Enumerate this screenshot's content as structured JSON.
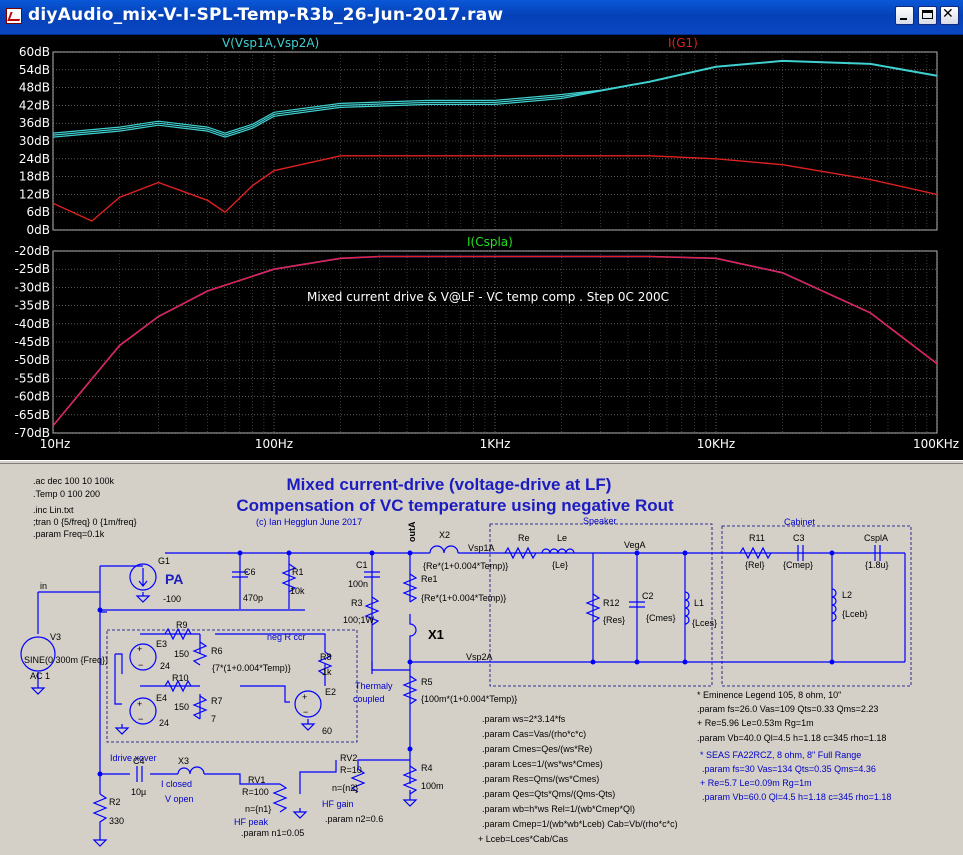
{
  "window": {
    "title": "diyAudio_mix-V-I-SPL-Temp-R3b_26-Jun-2017.raw",
    "buttons": [
      "minimize",
      "maximize",
      "close"
    ]
  },
  "plots": {
    "top_pane": {
      "traces": [
        {
          "label": "V(Vsp1A,Vsp2A)",
          "color": "#40d0d0"
        },
        {
          "label": "I(G1)",
          "color": "#e02020"
        }
      ],
      "y_ticks": [
        "60dB",
        "54dB",
        "48dB",
        "42dB",
        "36dB",
        "30dB",
        "24dB",
        "18dB",
        "12dB",
        "6dB",
        "0dB"
      ]
    },
    "bottom_pane": {
      "traces": [
        {
          "label": "I(Cspla)",
          "color": "#20e020"
        }
      ],
      "annotation": "Mixed current drive & V@LF - VC temp comp . Step 0C 200C",
      "y_ticks": [
        "-20dB",
        "-25dB",
        "-30dB",
        "-35dB",
        "-40dB",
        "-45dB",
        "-50dB",
        "-55dB",
        "-60dB",
        "-65dB",
        "-70dB"
      ]
    },
    "x_ticks": [
      "10Hz",
      "100Hz",
      "1KHz",
      "10KHz",
      "100KHz"
    ]
  },
  "chart_data": [
    {
      "type": "line",
      "x_scale": "log",
      "xlim": [
        10,
        100000
      ],
      "ylim": [
        0,
        60
      ],
      "series": [
        {
          "name": "V(Vsp1A,Vsp2A)",
          "x": [
            10,
            20,
            30,
            50,
            60,
            80,
            100,
            200,
            500,
            1000,
            2000,
            3000,
            5000,
            10000,
            20000,
            50000,
            100000
          ],
          "values": [
            32,
            34,
            36,
            34,
            32,
            35,
            39,
            42,
            43,
            43,
            45,
            47,
            50,
            55,
            57,
            56,
            52
          ]
        },
        {
          "name": "I(G1)",
          "x": [
            10,
            15,
            20,
            30,
            50,
            60,
            80,
            100,
            200,
            500,
            1000,
            3000,
            5000,
            10000,
            20000,
            50000,
            100000
          ],
          "values": [
            9,
            3,
            11,
            16,
            10,
            6,
            15,
            20,
            25,
            25,
            25,
            25,
            25,
            24,
            22,
            17,
            12
          ]
        }
      ]
    },
    {
      "type": "line",
      "x_scale": "log",
      "xlim": [
        10,
        100000
      ],
      "ylim": [
        -70,
        -20
      ],
      "series": [
        {
          "name": "I(Cspla)",
          "x": [
            10,
            20,
            30,
            50,
            100,
            200,
            300,
            500,
            1000,
            2000,
            5000,
            10000,
            20000,
            50000,
            100000
          ],
          "values": [
            -68,
            -46,
            -38,
            -31,
            -25,
            -22,
            -21.5,
            -21.5,
            -21.5,
            -21.5,
            -21.5,
            -22,
            -26,
            -37,
            -51
          ]
        }
      ]
    }
  ],
  "schematic": {
    "heading1": "Mixed current-drive (voltage-drive at LF)",
    "heading2": "Compensation of VC temperature using negative Rout",
    "credit": "(c) Ian Hegglun June 2017",
    "directives": [
      ".ac dec 100 10 100k",
      ".Temp 0 100 200",
      ".inc Lin.txt",
      ";tran 0 {5/freq} 0 {1m/freq}",
      ".param Freq=0.1k"
    ],
    "labels": {
      "speaker": "Speaker",
      "cabinet": "Cabinet",
      "g1": "G1",
      "g1_val": "-100",
      "pa": "PA",
      "c6": "C6",
      "c6_val": "470p",
      "r1": "R1",
      "r1_val": "10k",
      "c1": "C1",
      "c1_val": "100n",
      "r3": "R3",
      "r3_val": "100;1W",
      "re1": "Re1",
      "re1_val": "{Re*(1+0.004*Temp)}",
      "x1": "X1",
      "x2": "X2",
      "x2_val": "{Re*(1+0.004*Temp)}",
      "outa": "outA",
      "vsp1a": "Vsp1A",
      "vsp2a": "Vsp2A",
      "re": "Re",
      "le": "Le",
      "le_val": "{Le}",
      "vega": "VegA",
      "r12": "R12",
      "r12_val": "{Res}",
      "c2": "C2",
      "c2_val": "{Cmes}",
      "l1": "L1",
      "l1_val": "{Lces}",
      "r11": "R11",
      "r11_val": "{Rel}",
      "c3": "C3",
      "c3_val": "{Cmep}",
      "cspla": "CsplA",
      "cspla_val": "{1.8u}",
      "l2": "L2",
      "l2_val": "{Lceb}",
      "r5": "R5",
      "r5_val": "{100m*(1+0.004*Temp)}",
      "r4": "R4",
      "r4_val": "100m",
      "rv2": "RV2",
      "rv2_val": "R=10",
      "rv2_n": "n={n2}",
      "hf_gain": "HF gain",
      "n2": ".param n2=0.6",
      "rv1": "RV1",
      "rv1_val": "R=100",
      "rv1_n": "n={n1}",
      "hf_peak": "HF peak",
      "n1": ".param n1=0.05",
      "r9": "R9",
      "r9_val": "150",
      "r10": "R10",
      "r10_val": "150",
      "r6": "R6",
      "r6_val": "{7*(1+0.004*Temp)}",
      "r7": "R7",
      "r7_val": "7",
      "r8": "R8",
      "r8_val": "1k",
      "e3": "E3",
      "e3_val": "24",
      "e4": "E4",
      "e4_val": "24",
      "e2": "E2",
      "e2_val": "60",
      "neg_r": "neg R ccr",
      "thermally": "Thermaly",
      "coupled": "coupled",
      "v3": "V3",
      "v3_val": "SINE(0 300m {Freq})",
      "ac1": "AC 1",
      "in": "in",
      "idrive": "Idrive xover",
      "c4": "C4",
      "c4_val": "10µ",
      "x3": "X3",
      "closed": "I closed",
      "open": "V open",
      "r2": "R2",
      "r2_val": "330"
    },
    "params": [
      ".param ws=2*3.14*fs",
      ".param Cas=Vas/(rho*c*c)",
      ".param Cmes=Qes/(ws*Re)",
      ".param Lces=1/(ws*ws*Cmes)",
      ".param Res=Qms/(ws*Cmes)",
      ".param Qes=Qts*Qms/(Qms-Qts)",
      ".param wb=h*ws Rel=1/(wb*Cmep*Ql)",
      ".param Cmep=1/(wb*wb*Lceb) Cab=Vb/(rho*c*c)",
      "+ Lceb=Lces*Cab/Cas"
    ],
    "driver1": [
      "* Eminence Legend 105, 8 ohm, 10\"",
      ".param fs=26.0 Vas=109 Qts=0.33 Qms=2.23",
      "+ Re=5.96 Le=0.53m Rg=1m",
      ".param Vb=40.0 Ql=4.5 h=1.18 c=345 rho=1.18"
    ],
    "driver2": [
      "* SEAS FA22RCZ, 8 ohm, 8\" Full Range",
      ".param fs=30 Vas=134 Qts=0.35 Qms=4.36",
      "+ Re=5.7 Le=0.09m Rg=1m",
      ".param Vb=60.0 Ql=4.5 h=1.18 c=345 rho=1.18"
    ]
  }
}
